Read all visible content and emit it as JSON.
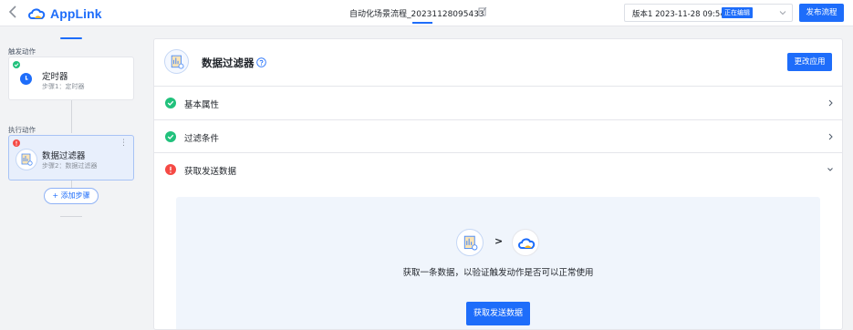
{
  "header": {
    "back_icon": "chevron-left-icon",
    "logo_text": "AppLink",
    "flow_title": "自动化场景流程_20231128095433",
    "version_label": "版本1",
    "version_time": "2023-11-28 09:54:42",
    "version_status": "正在编辑",
    "publish_label": "发布流程"
  },
  "sidebar": {
    "trigger_section_label": "触发动作",
    "action_section_label": "执行动作",
    "nodes": [
      {
        "title": "定时器",
        "subtitle": "步骤1：定时器",
        "status": "ok"
      },
      {
        "title": "数据过滤器",
        "subtitle": "步骤2：数据过滤器",
        "status": "error",
        "more": "⋮"
      }
    ],
    "add_step_label": "+ 添加步骤"
  },
  "main": {
    "title": "数据过滤器",
    "change_app_label": "更改应用",
    "sections": [
      {
        "label": "基本属性",
        "status": "ok",
        "chevron": "›"
      },
      {
        "label": "过滤条件",
        "status": "ok",
        "chevron": "›"
      },
      {
        "label": "获取发送数据",
        "status": "error",
        "chevron": "⌄"
      }
    ],
    "test": {
      "arrow": ">",
      "description": "获取一条数据，以验证触发动作是否可以正常使用",
      "button_label": "获取发送数据"
    }
  },
  "colors": {
    "primary": "#1e6dfa",
    "success": "#21c17c",
    "error": "#f54a45"
  }
}
